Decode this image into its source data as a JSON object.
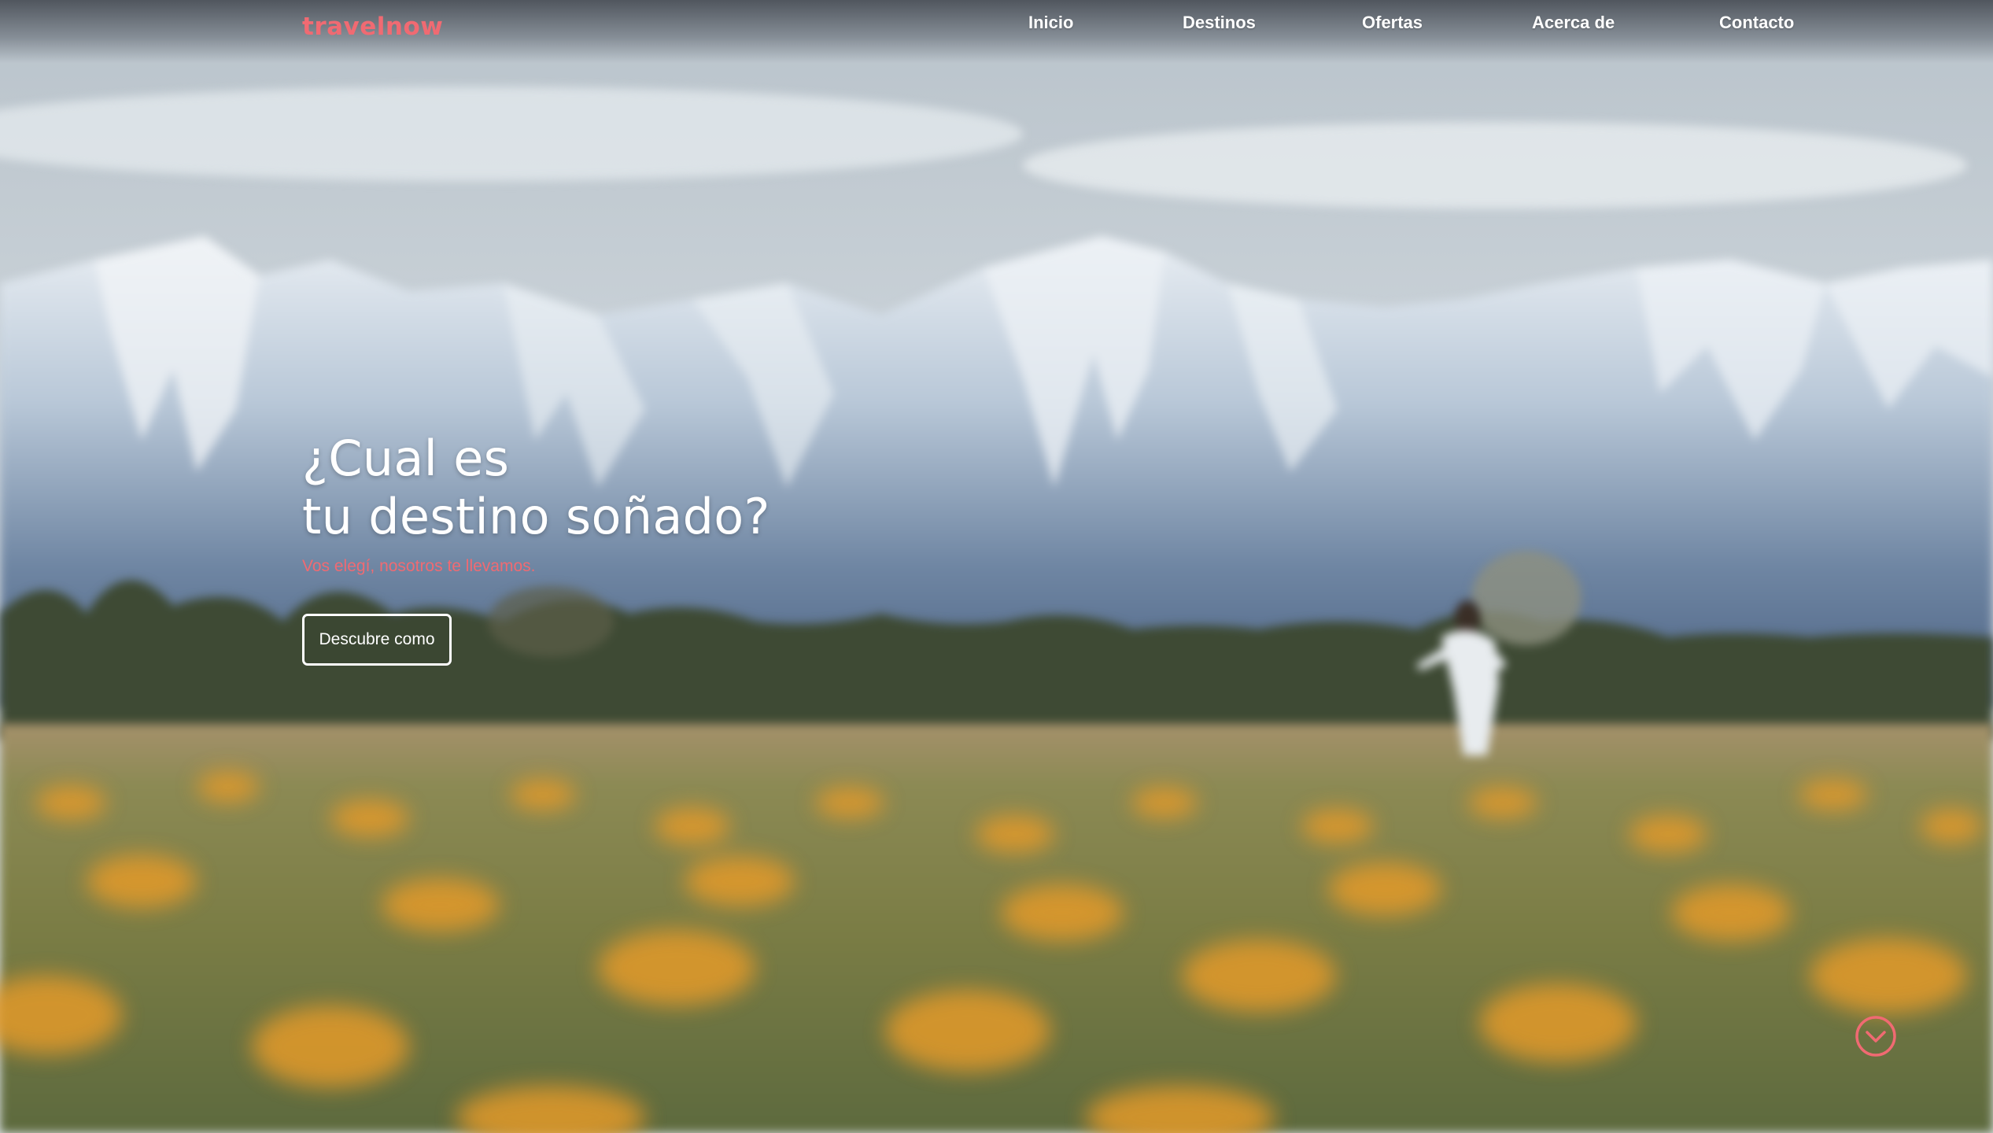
{
  "brand": {
    "name": "travelnow",
    "color": "#f06a72"
  },
  "nav": {
    "items": [
      {
        "label": "Inicio"
      },
      {
        "label": "Destinos"
      },
      {
        "label": "Ofertas"
      },
      {
        "label": "Acerca de"
      },
      {
        "label": "Contacto"
      }
    ]
  },
  "hero": {
    "title_line1": "¿Cual es",
    "title_line2": "tu destino soñado?",
    "subtitle": "Vos elegí, nosotros te llevamos.",
    "cta_label": "Descubre como",
    "background": "snowy-mountains-flower-field-photo"
  },
  "scroll": {
    "icon": "chevron-down-circle-icon",
    "color": "#f06a72"
  }
}
